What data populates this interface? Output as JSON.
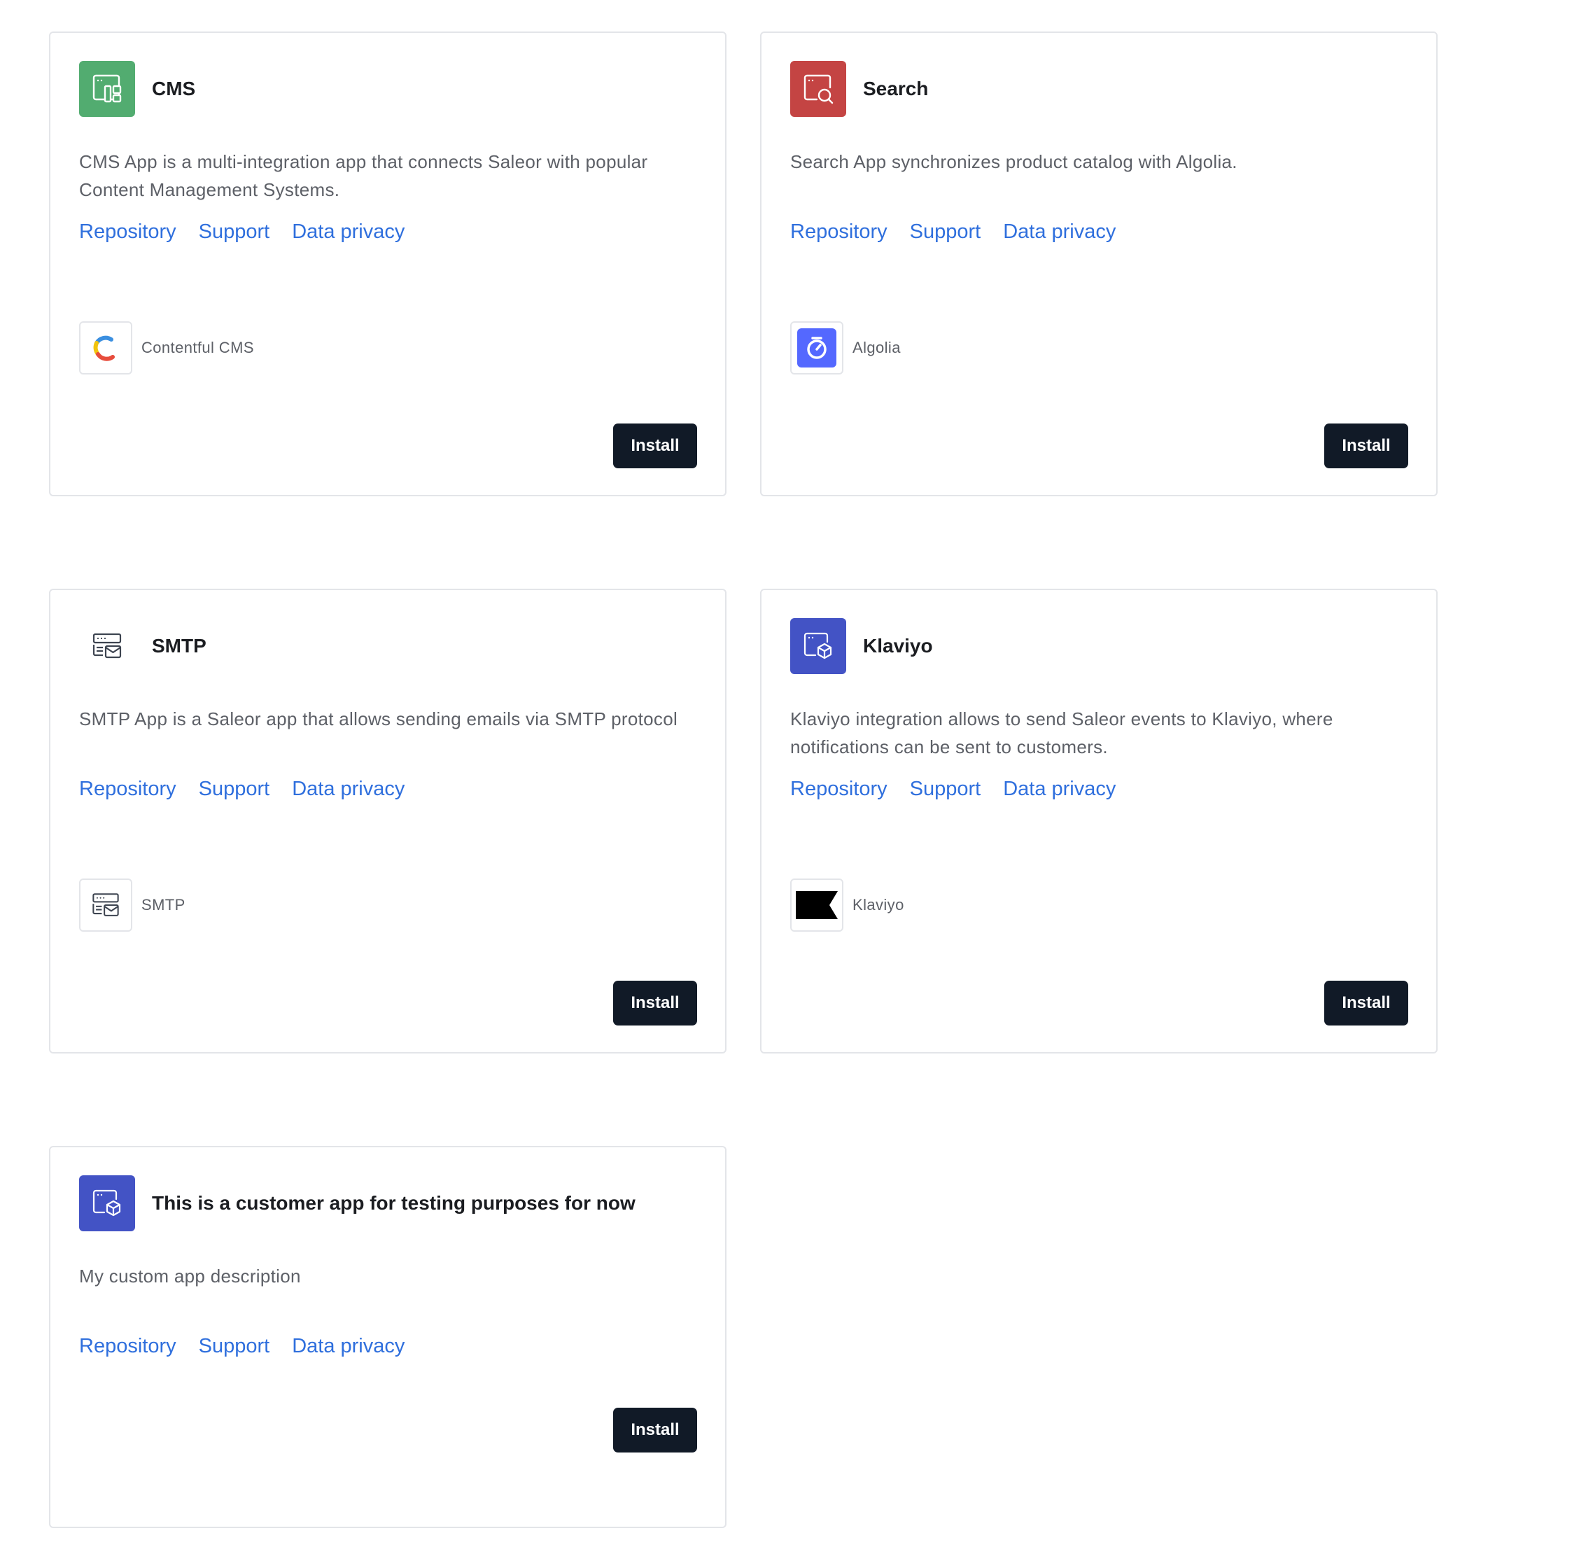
{
  "apps": [
    {
      "title": "CMS",
      "description": "CMS App is a multi-integration app that connects Saleor with popular Content Management Systems.",
      "icon": "cms-layout-icon",
      "icon_bg": "#52ac70",
      "links": {
        "repository": "Repository",
        "support": "Support",
        "data_privacy": "Data privacy"
      },
      "integration": {
        "name": "Contentful CMS",
        "icon": "contentful-logo"
      },
      "install_label": "Install"
    },
    {
      "title": "Search",
      "description": "Search App synchronizes product catalog with Algolia.",
      "icon": "search-window-icon",
      "icon_bg": "#c44443",
      "links": {
        "repository": "Repository",
        "support": "Support",
        "data_privacy": "Data privacy"
      },
      "integration": {
        "name": "Algolia",
        "icon": "algolia-logo"
      },
      "install_label": "Install"
    },
    {
      "title": "SMTP",
      "description": "SMTP App is a Saleor app that allows sending emails via SMTP protocol",
      "icon": "smtp-mail-icon",
      "icon_bg": "#ffffff",
      "links": {
        "repository": "Repository",
        "support": "Support",
        "data_privacy": "Data privacy"
      },
      "integration": {
        "name": "SMTP",
        "icon": "smtp-mail-icon"
      },
      "install_label": "Install"
    },
    {
      "title": "Klaviyo",
      "description": "Klaviyo integration allows to send Saleor events to Klaviyo, where notifications can be sent to customers.",
      "icon": "app-box-icon",
      "icon_bg": "#4353c5",
      "links": {
        "repository": "Repository",
        "support": "Support",
        "data_privacy": "Data privacy"
      },
      "integration": {
        "name": "Klaviyo",
        "icon": "klaviyo-flag-logo"
      },
      "install_label": "Install"
    },
    {
      "title": "This is a customer app for testing purposes for now",
      "description": "My custom app description",
      "icon": "app-box-icon",
      "icon_bg": "#4353c5",
      "links": {
        "repository": "Repository",
        "support": "Support",
        "data_privacy": "Data privacy"
      },
      "install_label": "Install"
    }
  ],
  "colors": {
    "link": "#2f6fdd",
    "button_bg": "#111a27",
    "border": "#e3e5e9",
    "text_muted": "#5d6067",
    "title": "#1b1d21"
  }
}
